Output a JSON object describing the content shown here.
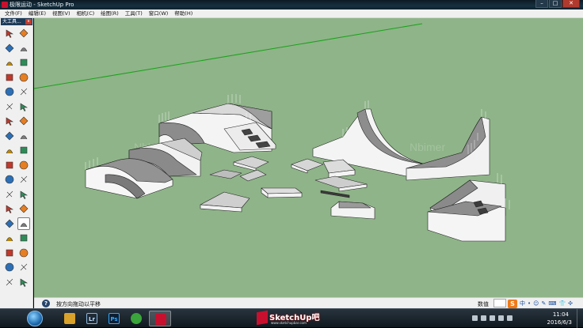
{
  "window": {
    "title": "极限运动 - SketchUp Pro",
    "controls": [
      "–",
      "□",
      "✕"
    ]
  },
  "menu": [
    "文件(F)",
    "编辑(E)",
    "视图(V)",
    "相机(C)",
    "绘图(R)",
    "工具(T)",
    "窗口(W)",
    "帮助(H)"
  ],
  "toolbar": {
    "title": "大工具...",
    "close": "x",
    "tools": [
      "select-tool",
      "eraser-tool",
      "paint-bucket-tool",
      "eraser-alt-tool",
      "pencil-tool",
      "freehand-tool",
      "rectangle-tool",
      "rotated-rectangle-tool",
      "circle-tool",
      "polygon-tool",
      "arc-tool",
      "two-point-arc-tool",
      "three-point-arc-tool",
      "pie-tool",
      "move-tool",
      "push-pull-tool",
      "rotate-tool",
      "follow-me-tool",
      "scale-tool",
      "offset-tool",
      "tape-measure-tool",
      "dimension-tool",
      "protractor-tool",
      "text-tool",
      "axes-tool",
      "3d-text-tool",
      "orbit-tool",
      "pan-tool",
      "zoom-tool",
      "zoom-window-tool",
      "zoom-extents-tool",
      "previous-view-tool",
      "position-camera-tool",
      "look-around-tool",
      "walk-tool",
      "section-plane-tool"
    ],
    "active_tool": "pan-tool"
  },
  "canvas": {
    "background": "#8fb489",
    "watermarks": [
      "Nbimer",
      "Nbimer"
    ]
  },
  "status": {
    "help": "?",
    "text": "按方向拖动以平移",
    "measure_label": "数值"
  },
  "ime": {
    "logo": "S",
    "items": [
      "中",
      "•",
      "☺",
      "✎",
      "⌨",
      "👕",
      "✣"
    ]
  },
  "taskbar": {
    "apps": [
      {
        "name": "windows-explorer",
        "label": ""
      },
      {
        "name": "lightroom",
        "label": "Lr"
      },
      {
        "name": "photoshop",
        "label": "Ps"
      },
      {
        "name": "browser",
        "label": ""
      },
      {
        "name": "sketchup",
        "label": ""
      }
    ],
    "logo_main": "SketchUp吧",
    "logo_sub": "www.sketchupbar.com",
    "clock_time": "11:04",
    "clock_date": "2016/6/3"
  }
}
